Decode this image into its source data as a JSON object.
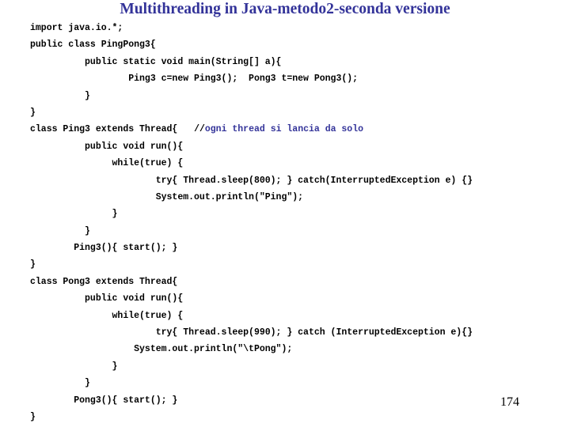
{
  "slide": {
    "title": "Multithreading in Java-metodo2-seconda versione",
    "title_color": "#333399",
    "background_color": "#ffffff",
    "page_number": "174"
  },
  "code": {
    "text_color": "#000000",
    "comment_color": "#333399",
    "lines": [
      {
        "text": "import java.io.*;"
      },
      {
        "text": "public class PingPong3{"
      },
      {
        "text": "          public static void main(String[] a){"
      },
      {
        "text": "                  Ping3 c=new Ping3();  Pong3 t=new Pong3();"
      },
      {
        "text": "          }"
      },
      {
        "text": "}"
      },
      {
        "text": "class Ping3 extends Thread{",
        "comment_slashes": "//",
        "comment": "ogni thread si lancia da solo",
        "comment_gap": "   "
      },
      {
        "text": "          public void run(){"
      },
      {
        "text": "               while(true) {"
      },
      {
        "text": "                       try{ Thread.sleep(800); } catch(InterruptedException e) {}"
      },
      {
        "text": "                       System.out.println(\"Ping\");"
      },
      {
        "text": "               }"
      },
      {
        "text": "          }"
      },
      {
        "text": "        Ping3(){ start(); }"
      },
      {
        "text": "}"
      },
      {
        "text": "class Pong3 extends Thread{"
      },
      {
        "text": "          public void run(){"
      },
      {
        "text": "               while(true) {"
      },
      {
        "text": "                       try{ Thread.sleep(990); } catch (InterruptedException e){}"
      },
      {
        "text": "                   System.out.println(\"\\tPong\");"
      },
      {
        "text": "               }"
      },
      {
        "text": "          }"
      },
      {
        "text": "        Pong3(){ start(); }"
      },
      {
        "text": "}"
      }
    ]
  }
}
